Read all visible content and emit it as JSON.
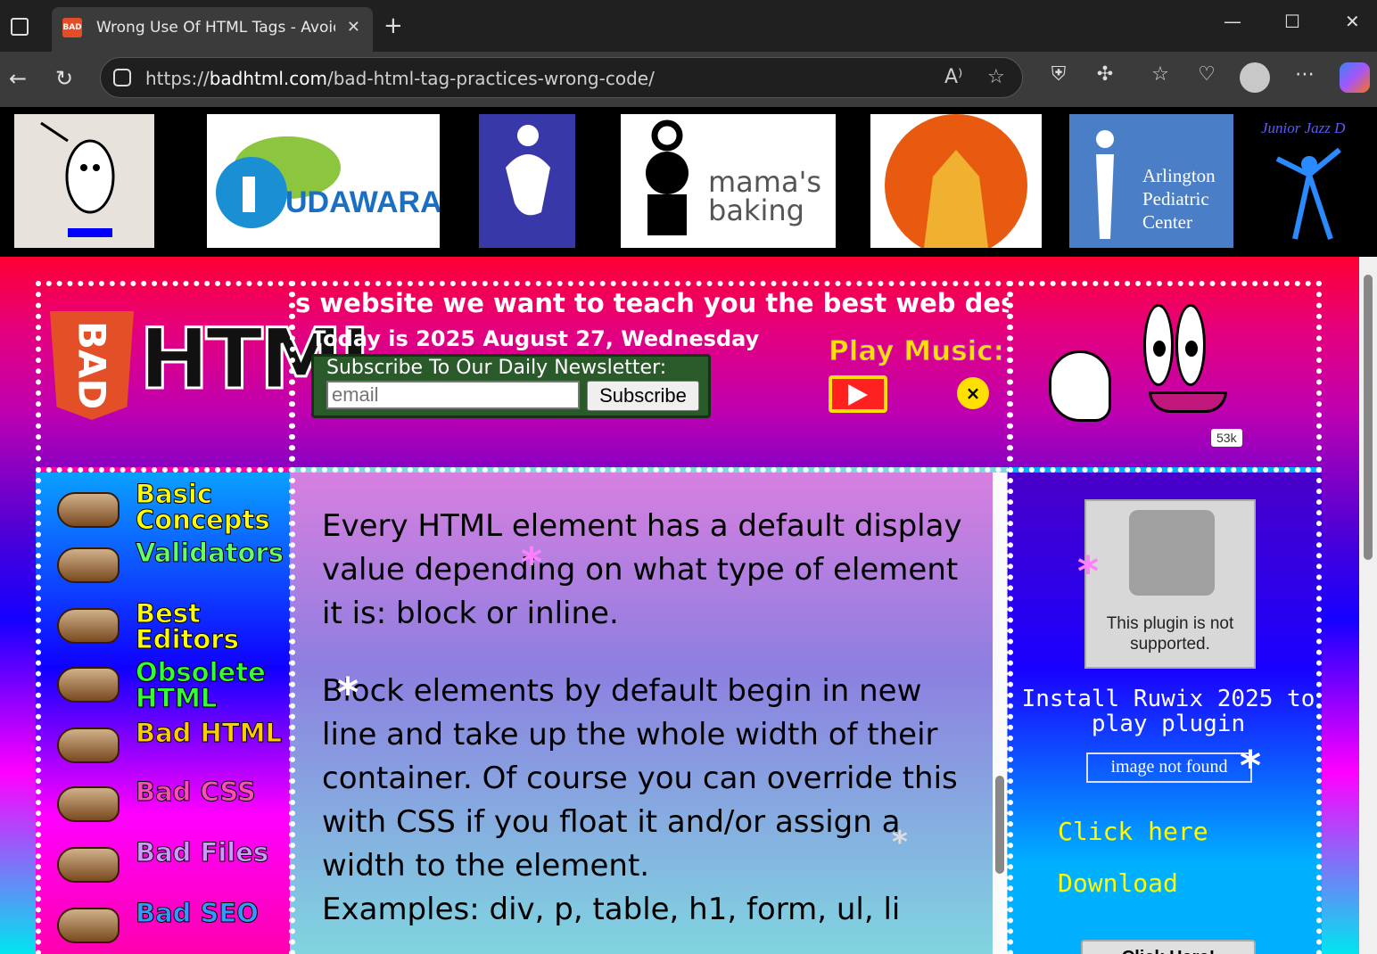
{
  "browser": {
    "tab_title": "Wrong Use Of HTML Tags - Avoid",
    "tab_favicon": "BAD",
    "new_tab_icon": "+",
    "url_prefix": "https://",
    "url_domain": "badhtml.com",
    "url_path": "/bad-html-tag-practices-wrong-code/"
  },
  "ads": {
    "kudawara": "UDAWARA",
    "mamas_baking": "mama's baking",
    "arlington": "Arlington Pediatric Center",
    "jazz": "Junior Jazz D"
  },
  "header": {
    "logo_bad": "BAD",
    "logo_html": "HTML",
    "marquee": "s website we want to teach you the best web design p",
    "today": "Today is 2025 August 27, Wednesday",
    "newsletter_label": "Subscribe To Our Daily Newsletter:",
    "email_placeholder": "email",
    "subscribe_label": "Subscribe",
    "play_music": "Play Music:",
    "close_symbol": "×",
    "counter": "53k"
  },
  "nav": {
    "items": [
      {
        "label": "Basic Concepts",
        "color": "#ffff00"
      },
      {
        "label": "Validators",
        "color": "#66ff66"
      },
      {
        "label": "Best Editors",
        "color": "#ffff00"
      },
      {
        "label": "Obsolete HTML",
        "color": "#33ff33"
      },
      {
        "label": "Bad HTML",
        "color": "#ffcc00"
      },
      {
        "label": "Bad CSS",
        "color": "#ff4db8"
      },
      {
        "label": "Bad Files",
        "color": "#cc99ff"
      },
      {
        "label": "Bad SEO",
        "color": "#3399ff"
      }
    ]
  },
  "main": {
    "p1": "Every HTML element has a default display value depending on what type of element it is: block or inline.",
    "p2": "Block elements by default begin in new line and take up the whole width of their container. Of course you can override this with CSS if you float it and/or assign a width to the element.",
    "p3": "Examples: div, p, table, h1, form, ul, li"
  },
  "sidebar": {
    "plugin_text": "This plugin is not supported.",
    "install": "Install Ruwix 2025 to play plugin",
    "image_not_found": "image not found",
    "click_here": "Click here",
    "download": "Download",
    "click_button": "Click Here!"
  }
}
